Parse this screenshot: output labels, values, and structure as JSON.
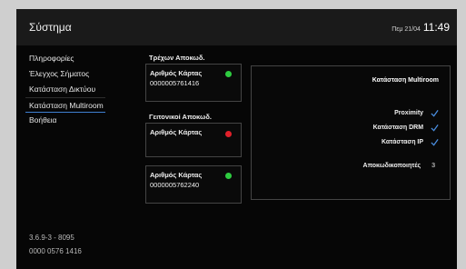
{
  "header": {
    "title": "Σύστημα",
    "date": "Πεμ 21/04",
    "time": "11:49"
  },
  "nav": {
    "items": [
      {
        "label": "Πληροφορίες"
      },
      {
        "label": "Έλεγχος Σήματος"
      },
      {
        "label": "Κατάσταση Δικτύου"
      },
      {
        "label": "Κατάσταση Multiroom",
        "active": true
      },
      {
        "label": "Βοήθεια"
      }
    ]
  },
  "current": {
    "label": "Τρέχων Αποκωδ.",
    "card": {
      "name": "Αριθμός Κάρτας",
      "number": "0000005761416",
      "status_color": "#2ecc40"
    }
  },
  "neighbors": {
    "label": "Γειτονικοί Αποκωδ.",
    "cards": [
      {
        "name": "Αριθμός Κάρτας",
        "number": "",
        "status_color": "#e0202a"
      },
      {
        "name": "Αριθμός Κάρτας",
        "number": "0000005762240",
        "status_color": "#2ecc40"
      }
    ]
  },
  "panel": {
    "title": "Κατάσταση Multiroom",
    "rows": [
      {
        "label": "Proximity",
        "icon": "check-icon"
      },
      {
        "label": "Κατάσταση DRM",
        "icon": "check-icon"
      },
      {
        "label": "Κατάσταση IP",
        "icon": "check-icon"
      }
    ],
    "decoders": {
      "label": "Αποκωδικοποιητές",
      "value": "3"
    }
  },
  "footer": {
    "version": "3.6.9-3 - 8095",
    "card_id": "0000 0576 1416"
  },
  "colors": {
    "accent": "#3f7fd0",
    "check": "#4a8ee0"
  }
}
